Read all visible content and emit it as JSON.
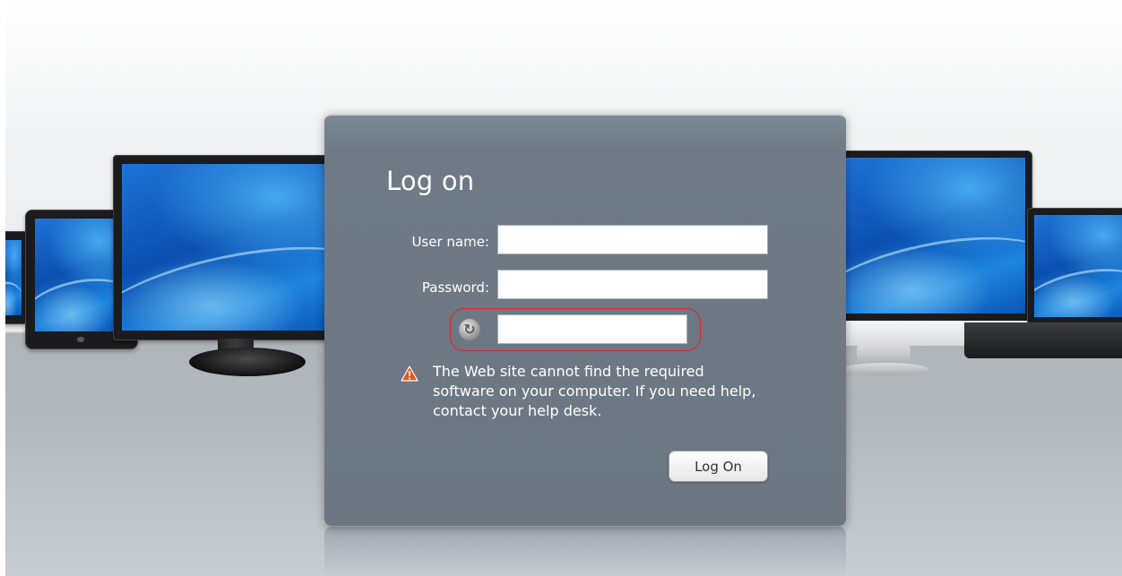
{
  "login": {
    "title": "Log on",
    "username_label": "User name:",
    "username_value": "",
    "password_label": "Password:",
    "password_value": "",
    "token_value": "",
    "warning_text": "The Web site cannot find the required software on your computer. If you need help, contact your help desk.",
    "submit_label": "Log On"
  },
  "icons": {
    "token": "refresh-icon",
    "warning": "warning-triangle-icon"
  },
  "colors": {
    "dialog_bg": "#6f7a86",
    "highlight_ring": "#e3222b",
    "warning_orange": "#e8551c"
  }
}
